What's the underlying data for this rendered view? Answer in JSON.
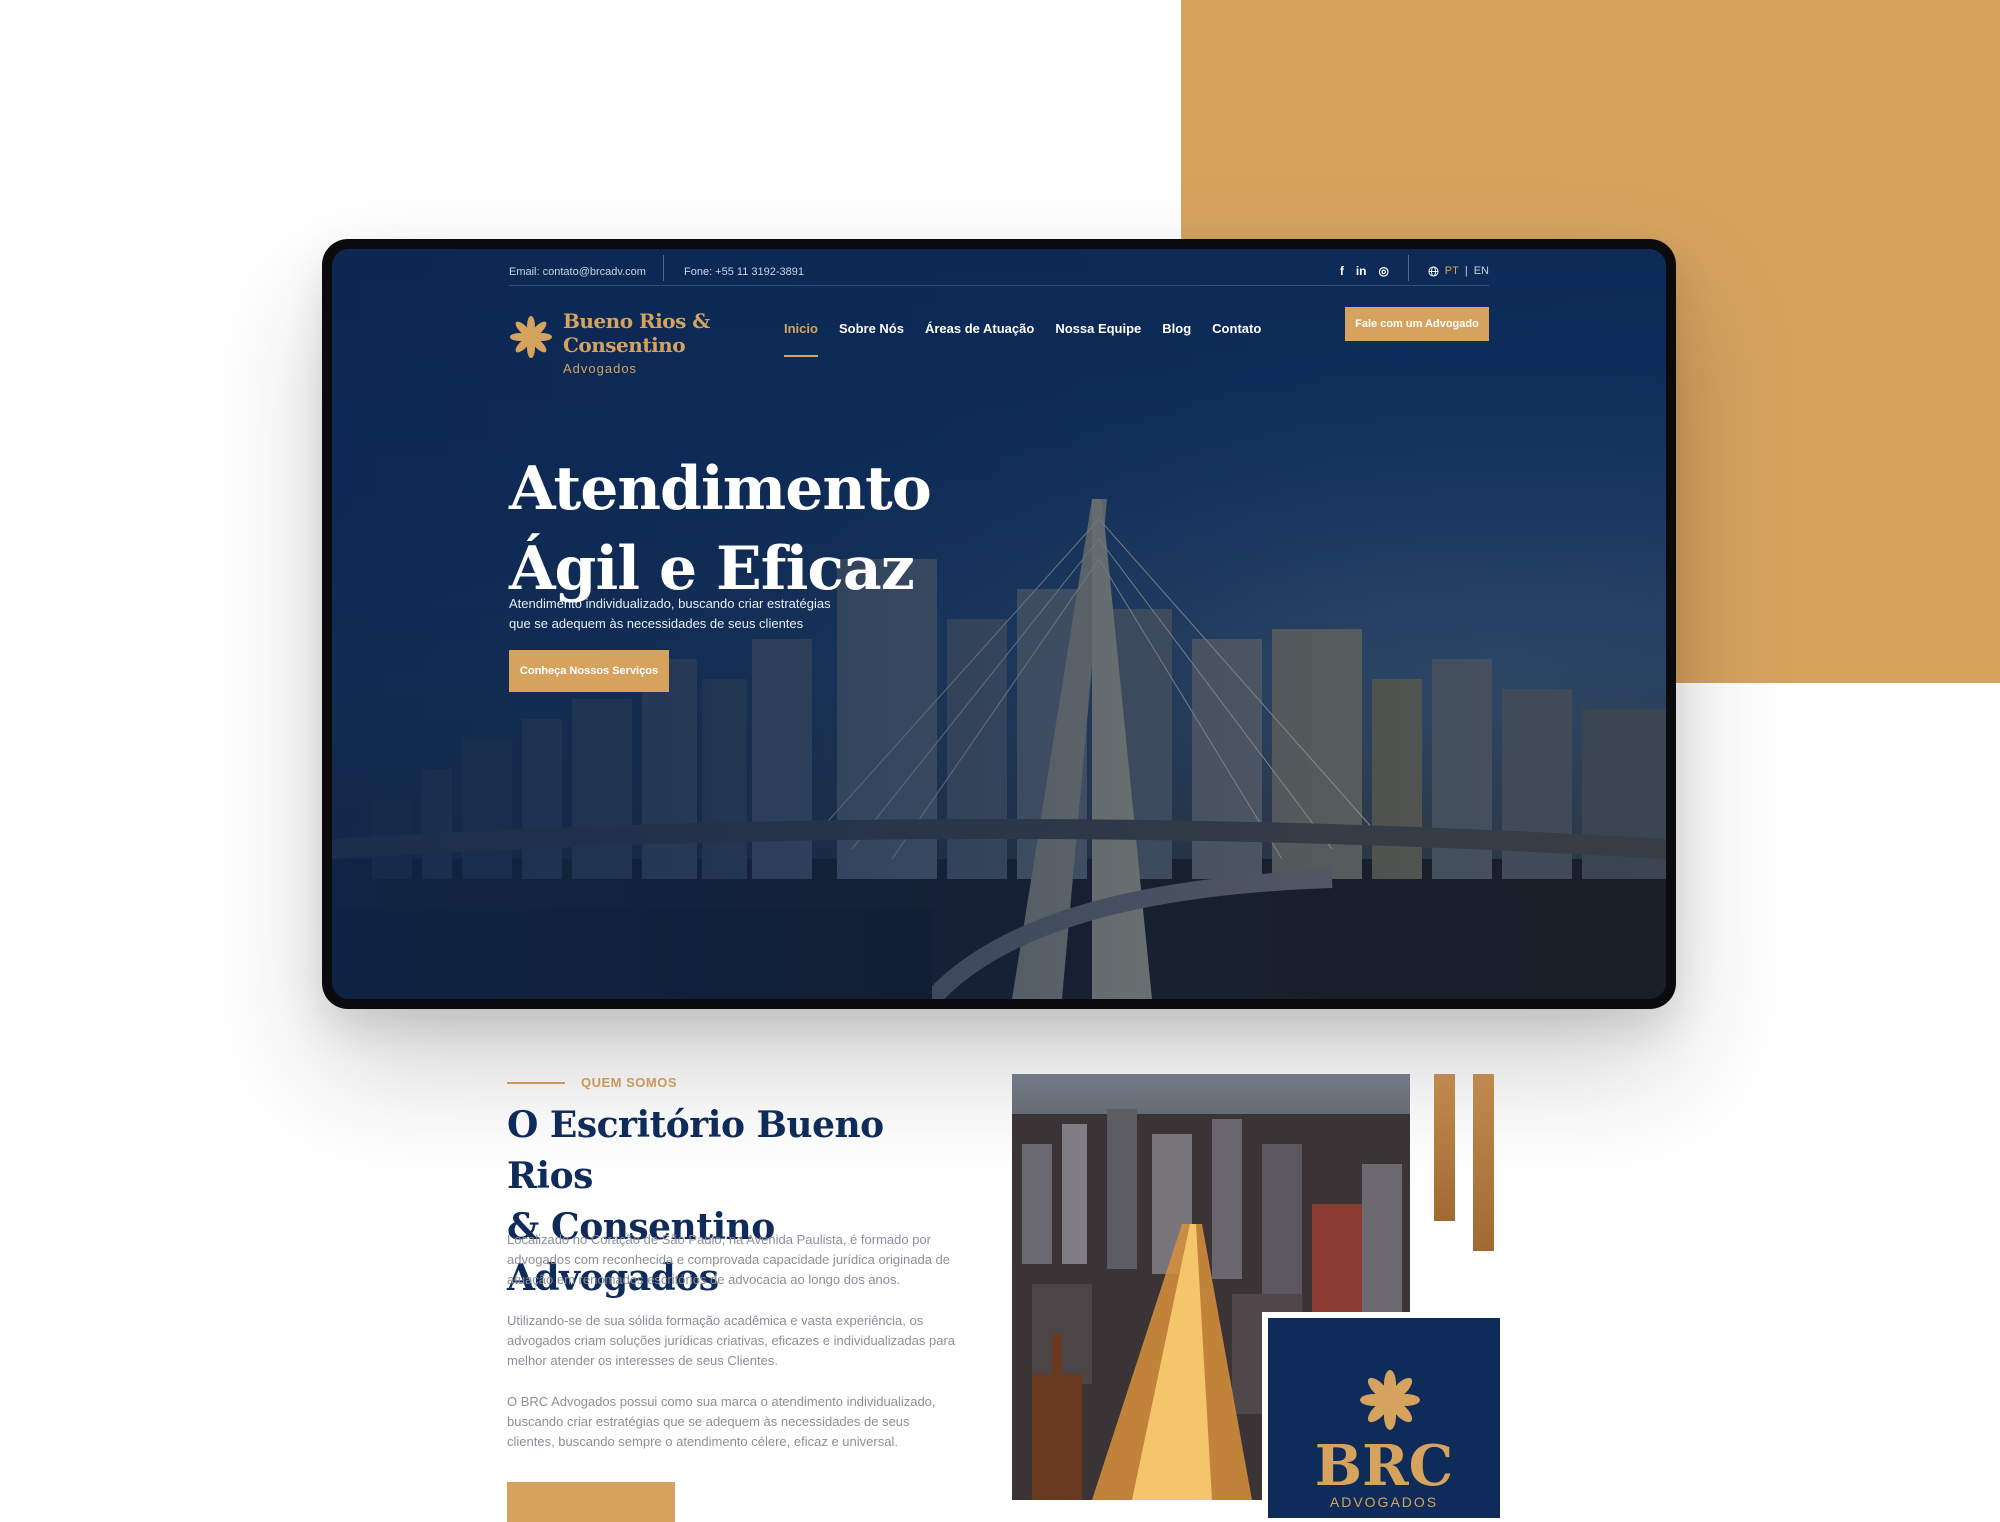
{
  "topbar": {
    "email": "Email: contato@brcadv.com",
    "phone": "Fone: +55 11 3192-3891",
    "social": [
      "f",
      "in",
      "◎"
    ],
    "lang_pt": "PT",
    "lang_sep": "|",
    "lang_en": "EN"
  },
  "brand": {
    "name_line1": "Bueno Rios &",
    "name_line2": "Consentino",
    "subtitle": "Advogados"
  },
  "nav": {
    "items": [
      {
        "label": "Inicio",
        "active": true
      },
      {
        "label": "Sobre Nós"
      },
      {
        "label": "Áreas de Atuação"
      },
      {
        "label": "Nossa Equipe"
      },
      {
        "label": "Blog"
      },
      {
        "label": "Contato"
      }
    ],
    "cta": "Fale com um Advogado"
  },
  "hero": {
    "title_line1": "Atendimento",
    "title_line2": "Ágil e Eficaz",
    "subtitle_line1": "Atendimento individualizado, buscando criar estratégias",
    "subtitle_line2": "que se adequem às necessidades de seus clientes",
    "cta": "Conheça Nossos Serviços"
  },
  "about": {
    "eyebrow": "QUEM SOMOS",
    "title_line1": "O Escritório Bueno Rios",
    "title_line2": "& Consentino Advogados",
    "paragraph1": "Localizado no Coração de São Paulo, na Avenida Paulista, é formado por advogados com reconhecida e comprovada capacidade jurídica originada de atuação em renomados escritórios de advocacia ao longo dos anos.",
    "paragraph2": "Utilizando-se de sua sólida formação acadêmica e vasta experiência,  os advogados criam soluções jurídicas criativas, eficazes e individualizadas para melhor atender os interesses de seus Clientes.",
    "paragraph3": "O BRC Advogados possui como sua marca o atendimento individualizado, buscando criar estratégias que se adequem às necessidades de seus clientes, buscando sempre o atendimento célere, eficaz e universal.",
    "card_brc": "BRC",
    "card_sub": "ADVOGADOS"
  },
  "colors": {
    "gold": "#d6a35f",
    "navy": "#0f2b59"
  }
}
